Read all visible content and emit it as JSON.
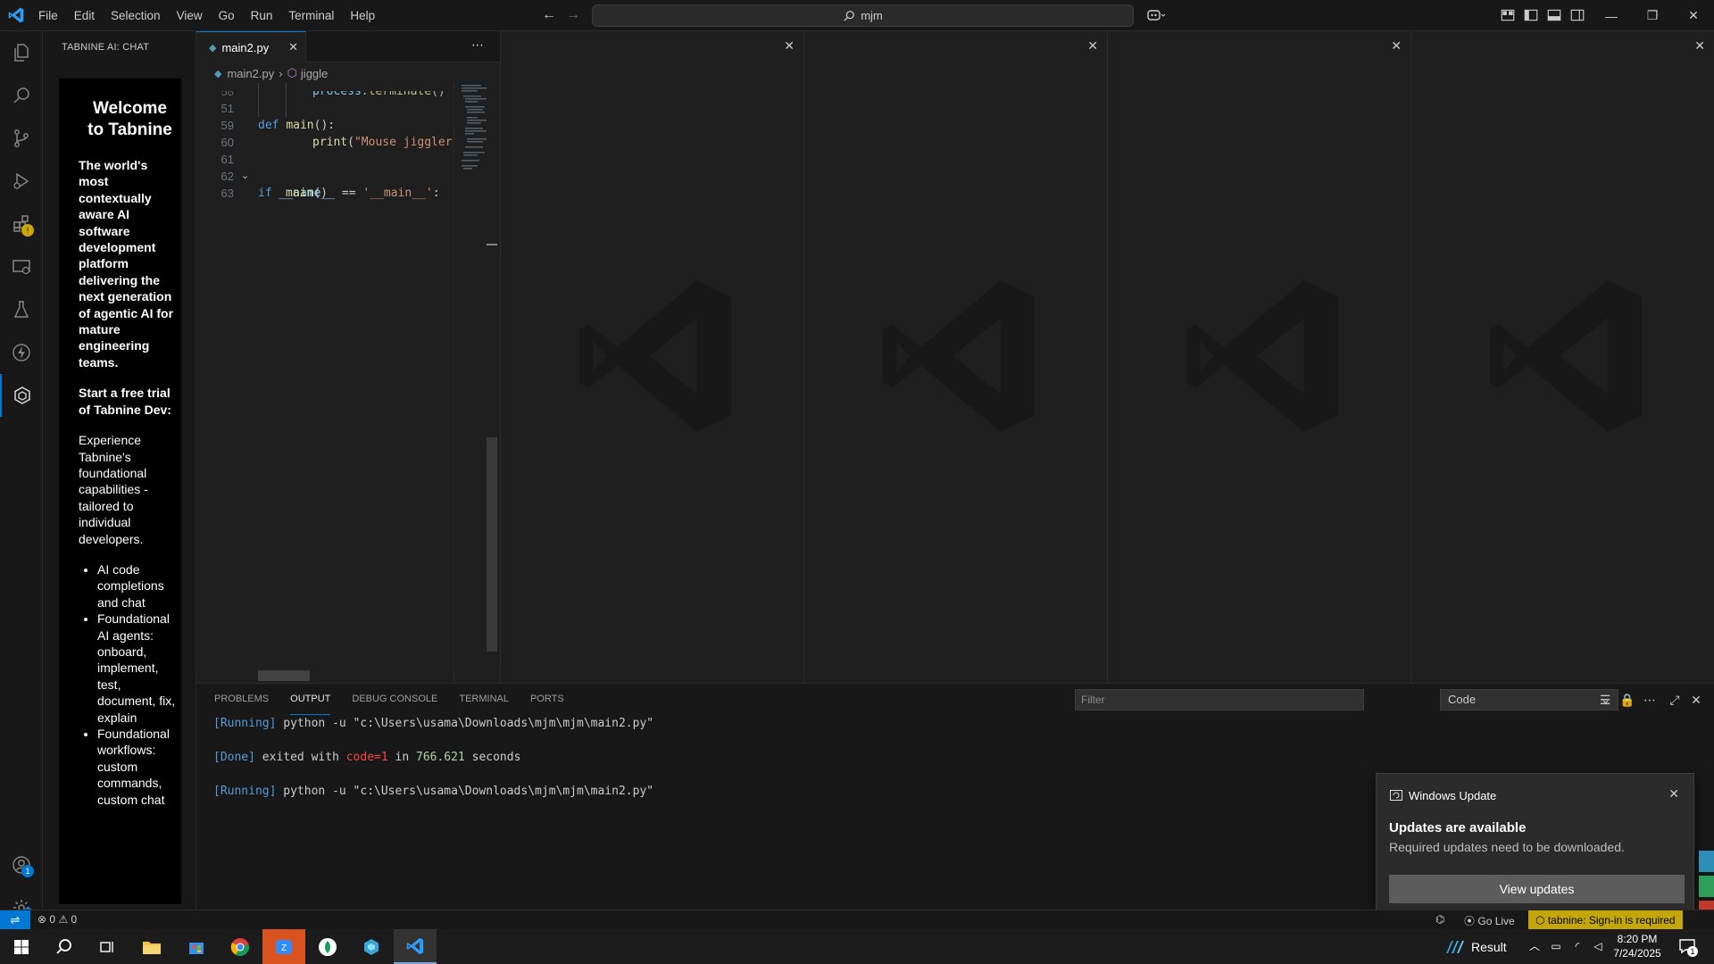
{
  "titlebar": {
    "menu": [
      "File",
      "Edit",
      "Selection",
      "View",
      "Go",
      "Run",
      "Terminal",
      "Help"
    ],
    "search_text": "mjm"
  },
  "sidebar": {
    "title": "TABNINE AI: CHAT",
    "chat": {
      "welcome": "Welcome to Tabnine",
      "intro": "The world's most contextually aware AI software development platform delivering the next generation of agentic AI for mature engineering teams.",
      "trial_heading": "Start a free trial of Tabnine Dev:",
      "trial_text": "Experience Tabnine's foundational capabilities - tailored to individual developers.",
      "features": [
        "AI code completions and chat",
        "Foundational AI agents: onboard, implement, test, document, fix, explain",
        "Foundational workflows: custom commands, custom chat"
      ]
    }
  },
  "editor": {
    "tab_label": "main2.py",
    "breadcrumb": {
      "file": "main2.py",
      "symbol": "jiggle"
    },
    "lines": [
      {
        "no": "51",
        "code": "def main():"
      },
      {
        "no": "58",
        "code": "process.terminate()"
      },
      {
        "no": "59",
        "code": "print(\"Mouse jiggler"
      },
      {
        "no": "60",
        "code": ""
      },
      {
        "no": "61",
        "code": "if __name__ == '__main__':"
      },
      {
        "no": "62",
        "code": "main()"
      },
      {
        "no": "63",
        "code": ""
      }
    ]
  },
  "panel": {
    "tabs": [
      "PROBLEMS",
      "OUTPUT",
      "DEBUG CONSOLE",
      "TERMINAL",
      "PORTS"
    ],
    "active_tab": "OUTPUT",
    "filter_placeholder": "Filter",
    "channel": "Code",
    "output": {
      "running_tag": "[Running]",
      "command": "python -u \"c:\\Users\\usama\\Downloads\\mjm\\mjm\\main2.py\"",
      "done_tag": "[Done]",
      "exited_with": "exited with",
      "code": "code=1",
      "in": "in",
      "seconds_value": "766.621",
      "seconds": "seconds"
    }
  },
  "statusbar": {
    "errors": "0",
    "warnings": "0",
    "go_live": "Go Live",
    "tabnine": "tabnine: Sign-in is required"
  },
  "toast": {
    "app": "Windows Update",
    "title": "Updates are available",
    "message": "Required updates need to be downloaded.",
    "button": "View updates"
  },
  "taskbar": {
    "weather": "Result",
    "time": "8:20 PM",
    "date": "7/24/2025",
    "notification_count": "1"
  },
  "colors": {
    "accent": "#0078d4",
    "tabnine_warning": "#c3a60a",
    "editor_bg": "#1f1f1f",
    "chrome_bg": "#181818"
  }
}
